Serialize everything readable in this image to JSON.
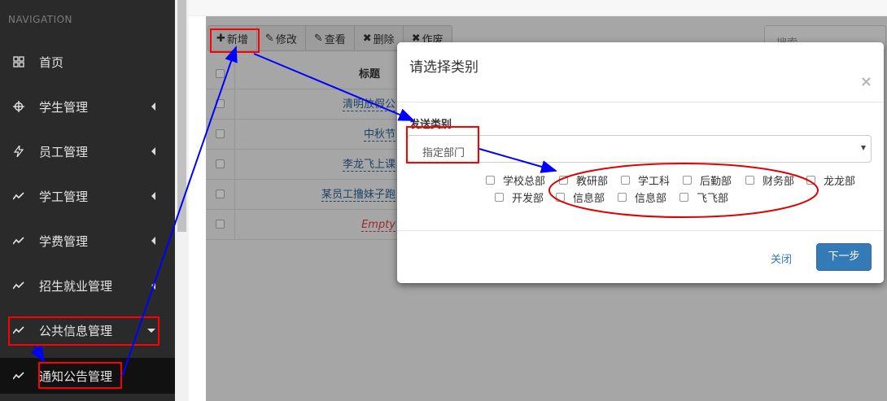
{
  "sidebar": {
    "header": "NAVIGATION",
    "items": [
      {
        "label": "首页",
        "icon": "grid-icon"
      },
      {
        "label": "学生管理",
        "icon": "crosshair-icon"
      },
      {
        "label": "员工管理",
        "icon": "bolt-icon"
      },
      {
        "label": "学工管理",
        "icon": "line-chart-icon"
      },
      {
        "label": "学费管理",
        "icon": "line-chart-icon"
      },
      {
        "label": "招生就业管理",
        "icon": "line-chart-icon"
      },
      {
        "label": "公共信息管理",
        "icon": "line-chart-icon"
      },
      {
        "label": "通知公告管理",
        "icon": "line-chart-icon"
      }
    ]
  },
  "toolbar": {
    "add_label": "新增",
    "edit_label": "修改",
    "view_label": "查看",
    "delete_label": "删除",
    "void_label": "作废"
  },
  "search": {
    "placeholder": "搜索"
  },
  "table": {
    "header_title": "标题",
    "rows": [
      {
        "title": "清明放假公"
      },
      {
        "title": "中秋节"
      },
      {
        "title": "李龙飞上课"
      },
      {
        "title": "某员工撸妹子跑"
      },
      {
        "title": "Empty"
      }
    ]
  },
  "modal": {
    "title": "请选择类别",
    "close_symbol": "×",
    "field_label": "发送类别",
    "select_value": "指定部门",
    "departments": [
      "学校总部",
      "教研部",
      "学工科",
      "后勤部",
      "财务部",
      "龙龙部",
      "开发部",
      "信息部",
      "信息部",
      "飞飞部"
    ],
    "close_button": "关闭",
    "next_button": "下一步"
  },
  "colors": {
    "sidebar_bg": "#2a2a2a",
    "primary": "#337ab7",
    "annotation_red": "#ff0000",
    "annotation_blue": "#0000ff"
  }
}
